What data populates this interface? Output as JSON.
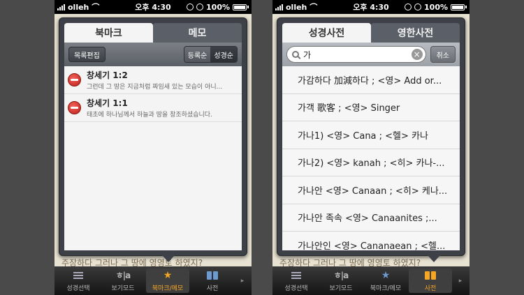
{
  "left": {
    "status": {
      "carrier": "olleh",
      "time": "오후 4:30",
      "battery": "100%"
    },
    "behind_text": "주장하다 그러나 그 땅에 영영토 하였지?",
    "tabs": {
      "active": "북마크",
      "inactive": "메모"
    },
    "toolbar": {
      "edit": "목록편집",
      "sort_reg": "등록순",
      "sort_bible": "성경순"
    },
    "bookmarks": [
      {
        "title": "창세기 1:2",
        "snippet": "그런데 그 땅은 지금처럼 짜임새 있는 모습이 아니..."
      },
      {
        "title": "창세기 1:1",
        "snippet": "태초에 하나님께서 하늘과 땅을 창조하셨습니다."
      }
    ],
    "tabbar": {
      "t1": "성경선택",
      "t2": "보기모드",
      "t3": "북마크/메모",
      "t4": "사전",
      "hla": "ㅎ|a"
    }
  },
  "right": {
    "status": {
      "carrier": "olleh",
      "time": "오후 4:30",
      "battery": "100%"
    },
    "behind_text": "주장하다 그러나 그 땅에 영영토 하였지?",
    "tabs": {
      "active": "성경사전",
      "inactive": "영한사전"
    },
    "search": {
      "value": "가",
      "cancel": "취소"
    },
    "entries": [
      "가감하다   加減하다 ; <영> Add or...",
      "가객   歌客 ; <영> Singer",
      "가나1)   <영> Cana ; <헬> 카나",
      "가나2)    <영> kanah ; <히> 카나-...",
      "가나안   <영> Canaan ; <히> 케나...",
      "가나안 족속   <영> Canaanites ;...",
      "가나안인   <영> Cananaean ; <헬..."
    ],
    "tabbar": {
      "t1": "성경선택",
      "t2": "보기모드",
      "t3": "북마크/메모",
      "t4": "사전",
      "hla": "ㅎ|a"
    }
  },
  "colors": {
    "accent": "#f5a623",
    "delete": "#d8322c"
  }
}
